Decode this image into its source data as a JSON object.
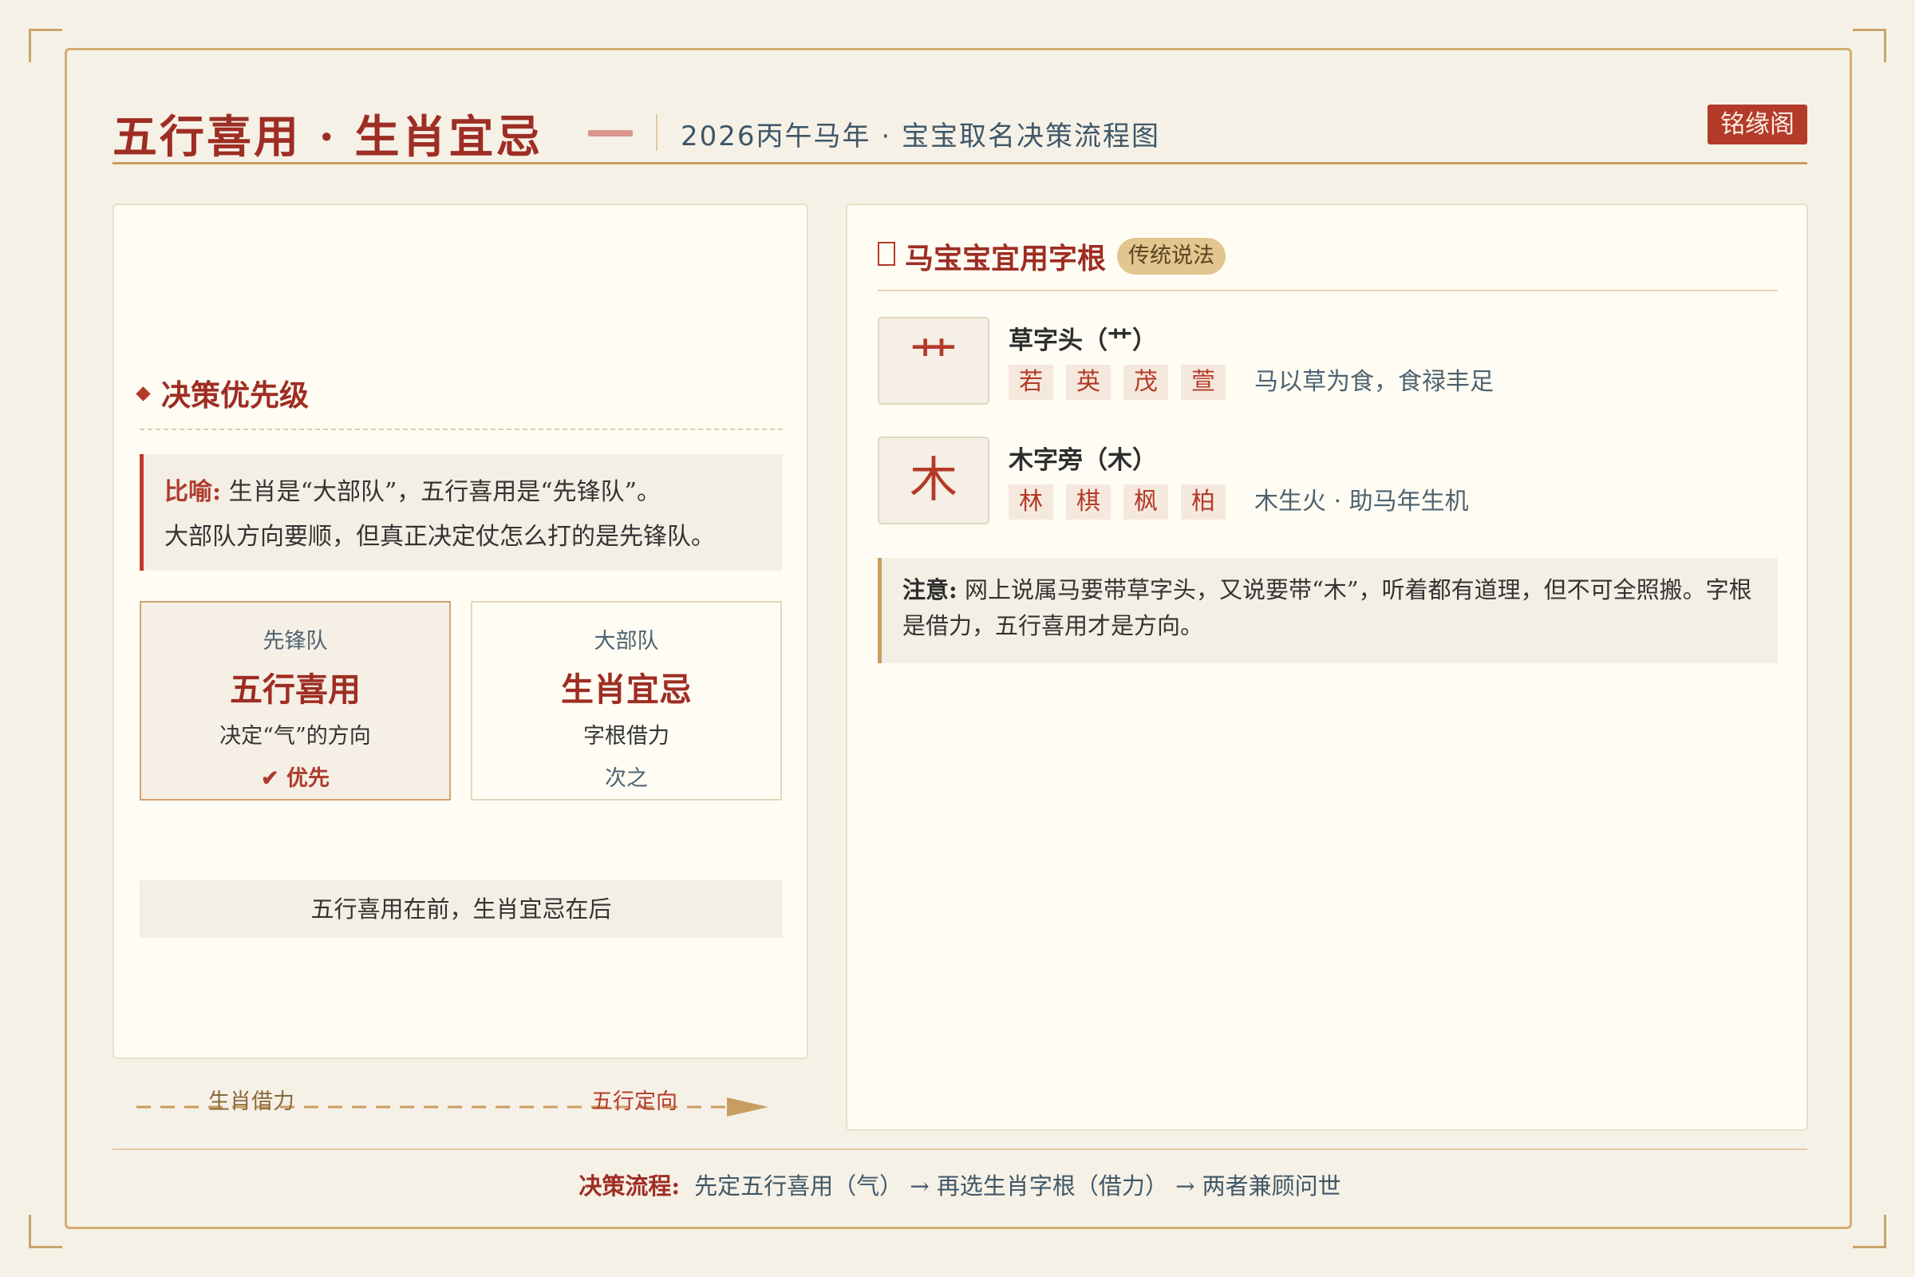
{
  "header": {
    "title": "五行喜用 · 生肖宜忌",
    "subtitle": "2026丙午马年 · 宝宝取名决策流程图",
    "brand": "铭缘阁"
  },
  "left": {
    "section_title": "决策优先级",
    "quote_label": "比喻:",
    "quote_line1": "生肖是“大部队”，五行喜用是“先锋队”。",
    "quote_line2": "大部队方向要顺，但真正决定仗怎么打的是先锋队。",
    "cards": [
      {
        "kicker": "先锋队",
        "value": "五行喜用",
        "desc": "决定“气”的方向",
        "status": "✔ 优先"
      },
      {
        "kicker": "大部队",
        "value": "生肖宜忌",
        "desc": "字根借力",
        "status": "次之"
      }
    ],
    "summary": "五行喜用在前，生肖宜忌在后"
  },
  "flow": {
    "start_label": "生肖借力",
    "end_label": "五行定向",
    "colors": {
      "line": "#c99d62",
      "start_text": "#8a6a3d",
      "end_text": "#b43a2a"
    }
  },
  "right": {
    "title": "马宝宝宜用字根",
    "tag": "传统说法",
    "roots": [
      {
        "glyph": "艹",
        "name": "草字头（艹）",
        "chars": [
          "若",
          "英",
          "茂",
          "萱"
        ],
        "note": "马以草为食，食禄丰足"
      },
      {
        "glyph": "木",
        "name": "木字旁（木）",
        "chars": [
          "林",
          "棋",
          "枫",
          "柏"
        ],
        "note": "木生火 · 助马年生机"
      }
    ],
    "notice_label": "注意:",
    "notice_text": "网上说属马要带草字头，又说要带“木”，听着都有道理，但不可全照搬。字根是借力，五行喜用才是方向。"
  },
  "footer": {
    "label": "决策流程:",
    "text": "先定五行喜用（气） → 再选生肖字根（借力） → 两者兼顾问世"
  },
  "colors": {
    "accent": "#9e2d23",
    "brand_bg": "#b43a2a",
    "gold": "#c99d62",
    "slate": "#3f5768"
  }
}
